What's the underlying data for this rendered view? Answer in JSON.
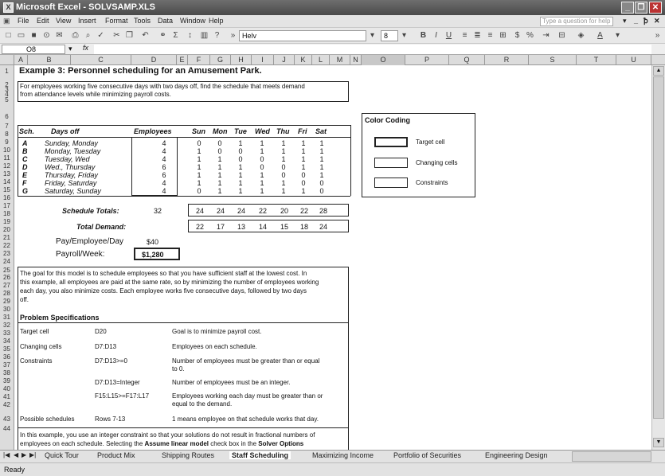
{
  "window": {
    "title": "Microsoft Excel - SOLVSAMP.XLS",
    "icon": "excel-icon"
  },
  "menu": [
    "File",
    "Edit",
    "View",
    "Insert",
    "Format",
    "Tools",
    "Data",
    "Window",
    "Help"
  ],
  "help_placeholder": "Type a question for help",
  "toolbar": {
    "font": "Helv",
    "size": "8"
  },
  "formula": {
    "cell_ref": "O8",
    "fx": "fx"
  },
  "columns": [
    "A",
    "B",
    "C",
    "D",
    "E",
    "F",
    "G",
    "H",
    "I",
    "J",
    "K",
    "L",
    "M",
    "N",
    "O",
    "P",
    "Q",
    "R",
    "S",
    "T",
    "U"
  ],
  "rows": [
    "1",
    "2",
    "3",
    "4",
    "5",
    "6",
    "7",
    "8",
    "9",
    "10",
    "11",
    "12",
    "13",
    "14",
    "15",
    "16",
    "17",
    "18",
    "19",
    "20",
    "21",
    "22",
    "23",
    "24",
    "25",
    "26",
    "27",
    "28",
    "29",
    "30",
    "31",
    "32",
    "33",
    "34",
    "35",
    "36",
    "37",
    "38",
    "39",
    "40",
    "41",
    "42",
    "43",
    "44"
  ],
  "sheet": {
    "title": "Example 3:  Personnel scheduling for an Amusement Park.",
    "intro": [
      "For employees working five consecutive days with two days off, find the schedule that meets demand",
      "from attendance levels while minimizing payroll costs."
    ],
    "headers": {
      "sch": "Sch.",
      "days": "Days off",
      "emp": "Employees",
      "days_of_week": [
        "Sun",
        "Mon",
        "Tue",
        "Wed",
        "Thu",
        "Fri",
        "Sat"
      ]
    },
    "schedules": [
      {
        "sch": "A",
        "days": "Sunday, Monday",
        "emp": "4",
        "v": [
          "0",
          "0",
          "1",
          "1",
          "1",
          "1",
          "1"
        ]
      },
      {
        "sch": "B",
        "days": "Monday, Tuesday",
        "emp": "4",
        "v": [
          "1",
          "0",
          "0",
          "1",
          "1",
          "1",
          "1"
        ]
      },
      {
        "sch": "C",
        "days": "Tuesday, Wed",
        "emp": "4",
        "v": [
          "1",
          "1",
          "0",
          "0",
          "1",
          "1",
          "1"
        ]
      },
      {
        "sch": "D",
        "days": "Wed., Thursday",
        "emp": "6",
        "v": [
          "1",
          "1",
          "1",
          "0",
          "0",
          "1",
          "1"
        ]
      },
      {
        "sch": "E",
        "days": "Thursday, Friday",
        "emp": "6",
        "v": [
          "1",
          "1",
          "1",
          "1",
          "0",
          "0",
          "1"
        ]
      },
      {
        "sch": "F",
        "days": "Friday, Saturday",
        "emp": "4",
        "v": [
          "1",
          "1",
          "1",
          "1",
          "1",
          "0",
          "0"
        ]
      },
      {
        "sch": "G",
        "days": "Saturday, Sunday",
        "emp": "4",
        "v": [
          "0",
          "1",
          "1",
          "1",
          "1",
          "1",
          "0"
        ]
      }
    ],
    "schedule_totals": {
      "label": "Schedule Totals:",
      "value": "32",
      "days": [
        "24",
        "24",
        "24",
        "22",
        "20",
        "22",
        "28"
      ]
    },
    "total_demand": {
      "label": "Total Demand:",
      "days": [
        "22",
        "17",
        "13",
        "14",
        "15",
        "18",
        "24"
      ]
    },
    "pay": {
      "label": "Pay/Employee/Day",
      "value": "$40"
    },
    "payroll": {
      "label": "Payroll/Week:",
      "value": "$1,280"
    },
    "color_coding": {
      "title": "Color Coding",
      "items": [
        "Target cell",
        "Changing cells",
        "Constraints"
      ]
    },
    "goal_text": [
      "The goal for this model is to schedule employees so that you have sufficient staff at the lowest cost.  In",
      "this example, all employees are paid at the same rate, so by minimizing the number of employees working",
      "each day, you also minimize costs.  Each employee works five consecutive days, followed by two days",
      "off."
    ],
    "problem_title": "Problem Specifications",
    "specs": [
      {
        "a": "Target cell",
        "b": "D20",
        "c": "Goal is to minimize payroll cost.",
        "c2": ""
      },
      {
        "a": "Changing cells",
        "b": "D7:D13",
        "c": "Employees on each schedule.",
        "c2": ""
      },
      {
        "a": "Constraints",
        "b": "D7:D13>=0",
        "c": "Number of employees must be greater than or equal",
        "c2": "to 0."
      },
      {
        "a": "",
        "b": "D7:D13=Integer",
        "c": "Number of employees must be an integer.",
        "c2": ""
      },
      {
        "a": "",
        "b": "F15:L15>=F17:L17",
        "c": "Employees working each day must be greater than or",
        "c2": "equal to the demand."
      },
      {
        "a": "Possible schedules",
        "b": "Rows 7-13",
        "c": "1 means employee on that schedule works that day.",
        "c2": ""
      }
    ],
    "footer_text": [
      "In this example, you use an integer constraint so that your solutions do not result in fractional numbers of",
      "employees on each schedule.  Selecting the "
    ],
    "footer_bold1": "Assume linear model",
    "footer_mid": " check box in the ",
    "footer_bold2": "Solver Options"
  },
  "tabs": [
    "Quick Tour",
    "Product Mix",
    "Shipping Routes",
    "Staff Scheduling",
    "Maximizing Income",
    "Portfolio of Securities",
    "Engineering Design"
  ],
  "active_tab": "Staff Scheduling",
  "status": "Ready"
}
